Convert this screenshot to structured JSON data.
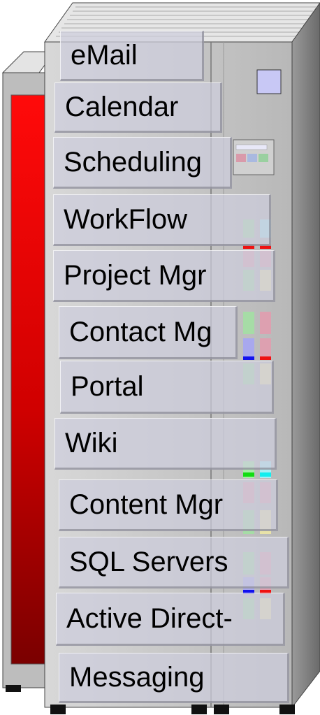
{
  "labels": [
    "eMail",
    "Calendar",
    "Scheduling",
    "WorkFlow",
    "Project Mgr",
    "Contact Mg",
    "Portal",
    "Wiki",
    "Content Mgr",
    "SQL Servers",
    "Active Direct-",
    "Messaging"
  ],
  "colors": {
    "side_panel": "#e00000",
    "chassis": "#c6c6c6",
    "label_bg": "#cdcddc",
    "power_button": "#c8c8f5"
  }
}
